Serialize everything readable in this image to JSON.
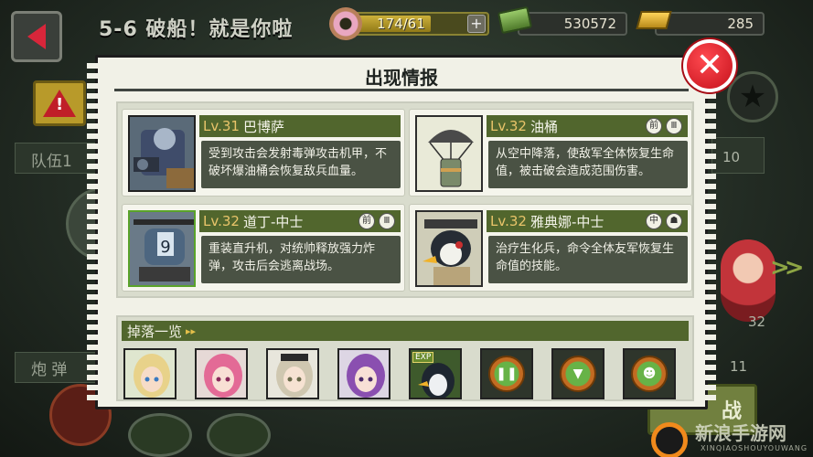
{
  "header": {
    "stage_title": "5-6 破船！就是你啦",
    "stamina": "174/61",
    "stamina_fraction": 0.75,
    "stamina_plus": "+",
    "money": "530572",
    "gold": "285"
  },
  "background": {
    "team_label": "队伍1",
    "shell_label": "炮 弹",
    "right_num_1": "10",
    "right_num_2": "32",
    "right_num_3": "11",
    "fight_label": "战"
  },
  "dialog": {
    "title": "出现情报",
    "enemies": [
      {
        "level": "Lv.31",
        "name": "巴博萨",
        "tags": [],
        "desc": "受到攻击会发射毒弹攻击机甲，不破坏爆油桶会恢复敌兵血量。"
      },
      {
        "level": "Lv.32",
        "name": "油桶",
        "tags": [
          "前",
          "Ⅲ"
        ],
        "desc": "从空中降落，使敌军全体恢复生命值，被击破会造成范围伤害。"
      },
      {
        "level": "Lv.32",
        "name": "道丁-中士",
        "tags": [
          "前",
          "Ⅲ"
        ],
        "desc": "重装直升机，对统帅释放强力炸弹，攻击后会逃离战场。"
      },
      {
        "level": "Lv.32",
        "name": "雅典娜-中士",
        "tags": [
          "中",
          "☗"
        ],
        "desc": "治疗生化兵，命令全体友军恢复生命值的技能。"
      }
    ],
    "drops_title": "掉落一览",
    "drops_chevron": "▸▸",
    "exp_label": "EXP"
  },
  "watermark": {
    "text": "新浪手游网",
    "sub": "XINQIAOSHOUYOUWANG"
  },
  "colors": {
    "accent_green": "#51662d",
    "level_gold": "#e9c46a",
    "close_red": "#c5101b"
  }
}
